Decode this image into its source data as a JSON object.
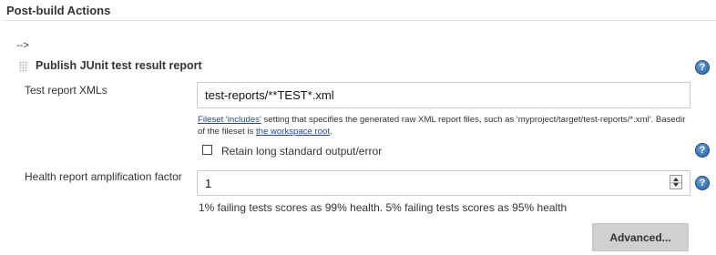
{
  "section": {
    "title": "Post-build Actions"
  },
  "arrow_text": "-->",
  "step": {
    "title": "Publish JUnit test result report",
    "help_glyph": "?"
  },
  "test_report_xmls": {
    "label": "Test report XMLs",
    "value": "test-reports/**TEST*.xml",
    "description_link1": "Fileset 'includes'",
    "description_mid": " setting that specifies the generated raw XML report files, such as 'myproject/target/test-reports/*.xml'. Basedir of the fileset is ",
    "description_link2": "the workspace root",
    "description_end": "."
  },
  "retain_output": {
    "label": "Retain long standard output/error",
    "checked": false
  },
  "health_factor": {
    "label": "Health report amplification factor",
    "value": "1",
    "description": "1% failing tests scores as 99% health. 5% failing tests scores as 95% health"
  },
  "advanced_button": {
    "label": "Advanced..."
  },
  "colors": {
    "help_icon": "#1f5c9e",
    "link": "#204a87",
    "button_bg": "#d0d0d0"
  }
}
